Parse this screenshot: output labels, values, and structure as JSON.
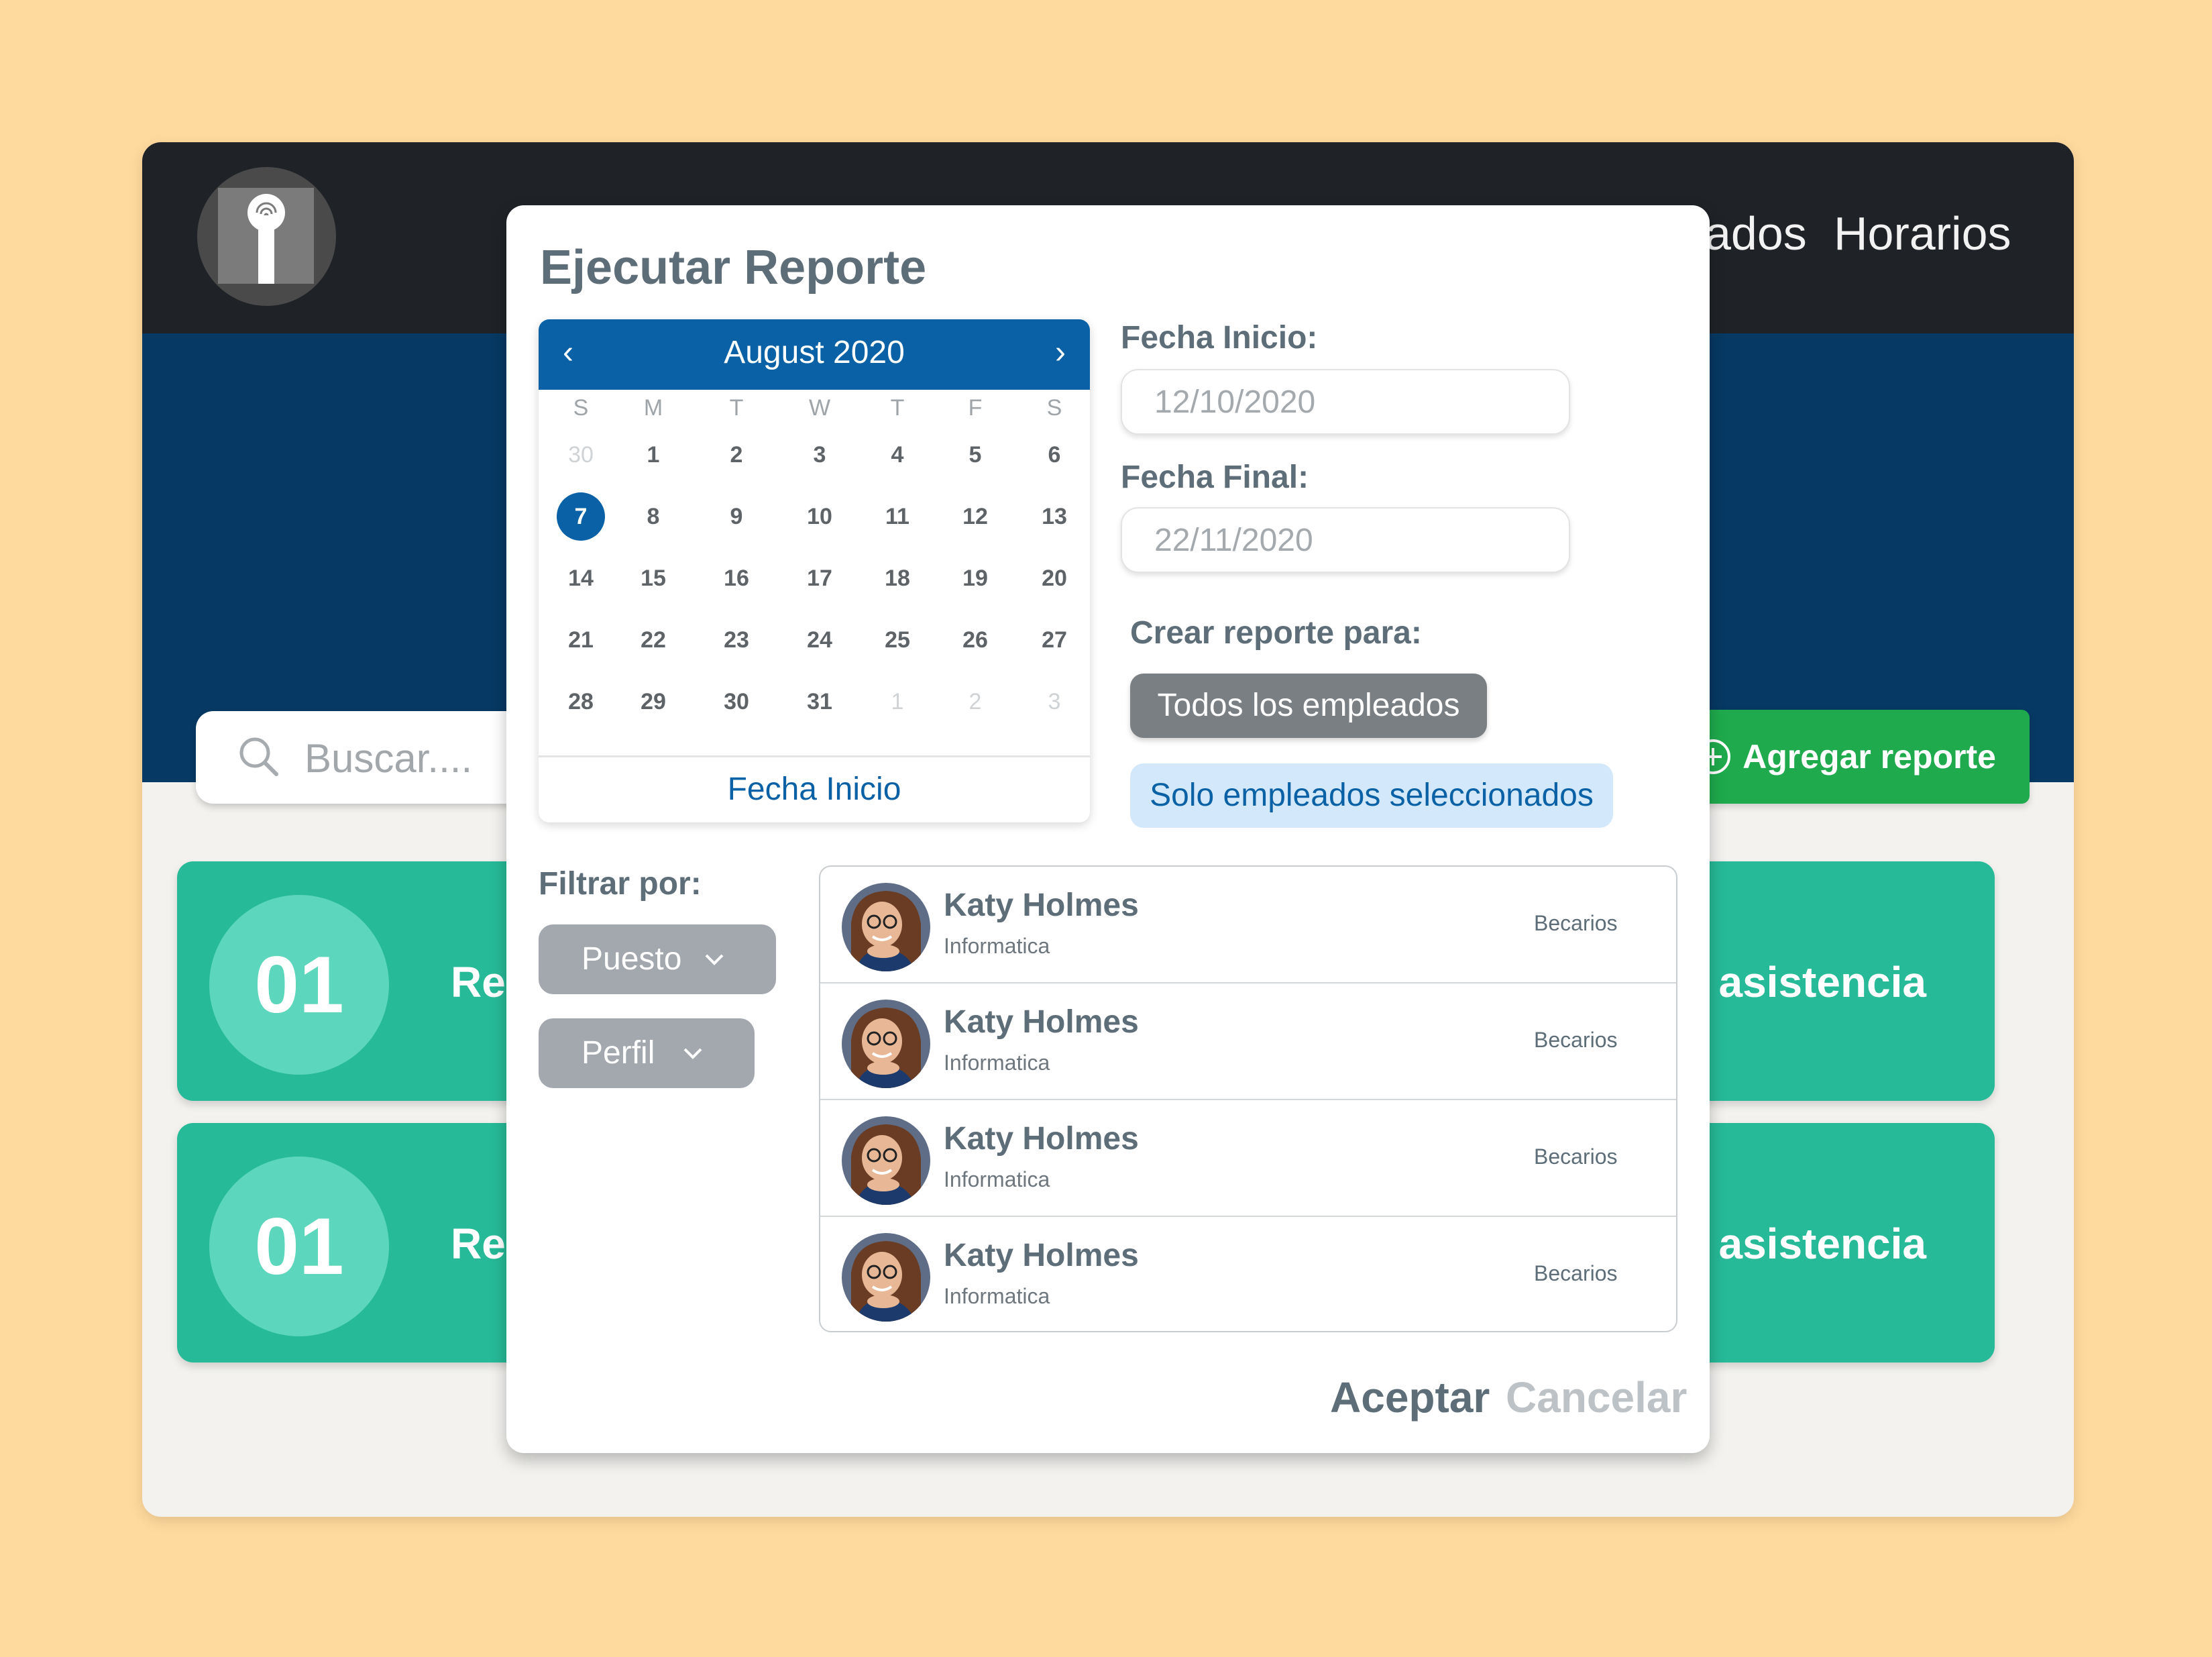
{
  "nav": {
    "items": [
      "ados",
      "Horarios"
    ]
  },
  "search": {
    "placeholder": "Buscar...."
  },
  "add_button": {
    "label": "Agregar reporte"
  },
  "cards": [
    {
      "number": "01",
      "title_left": "Re",
      "title_right": "e asistencia"
    },
    {
      "number": "01",
      "title_left": "Re",
      "title_right": "e asistencia"
    }
  ],
  "modal": {
    "title": "Ejecutar Reporte",
    "calendar": {
      "month": "August 2020",
      "prev": "‹",
      "next": "›",
      "weekdays": [
        "S",
        "M",
        "T",
        "W",
        "T",
        "F",
        "S"
      ],
      "weeks": [
        [
          "30",
          "1",
          "2",
          "3",
          "4",
          "5",
          "6"
        ],
        [
          "7",
          "8",
          "9",
          "10",
          "11",
          "12",
          "13"
        ],
        [
          "14",
          "15",
          "16",
          "17",
          "18",
          "19",
          "20"
        ],
        [
          "21",
          "22",
          "23",
          "24",
          "25",
          "26",
          "27"
        ],
        [
          "28",
          "29",
          "30",
          "31",
          "1",
          "2",
          "3"
        ]
      ],
      "selected": "7",
      "footer": "Fecha Inicio"
    },
    "start_date": {
      "label": "Fecha Inicio:",
      "placeholder": "12/10/2020"
    },
    "end_date": {
      "label": "Fecha Final:",
      "placeholder": "22/11/2020"
    },
    "report_for": {
      "label": "Crear reporte para:",
      "all": "Todos los empleados",
      "selected": "Solo empleados seleccionados"
    },
    "filter": {
      "label": "Filtrar por:",
      "position": "Puesto",
      "profile": "Perfil"
    },
    "employees": [
      {
        "name": "Katy Holmes",
        "dept": "Informatica",
        "group": "Becarios"
      },
      {
        "name": "Katy Holmes",
        "dept": "Informatica",
        "group": "Becarios"
      },
      {
        "name": "Katy Holmes",
        "dept": "Informatica",
        "group": "Becarios"
      },
      {
        "name": "Katy Holmes",
        "dept": "Informatica",
        "group": "Becarios"
      }
    ],
    "accept": "Aceptar",
    "cancel": "Cancelar"
  },
  "colors": {
    "page_bg": "#FFDA9E",
    "topbar": "#1F2327",
    "hero": "#063963",
    "card": "#26BA98",
    "accent_blue": "#0A61A6",
    "add_green": "#1FAB4D"
  }
}
